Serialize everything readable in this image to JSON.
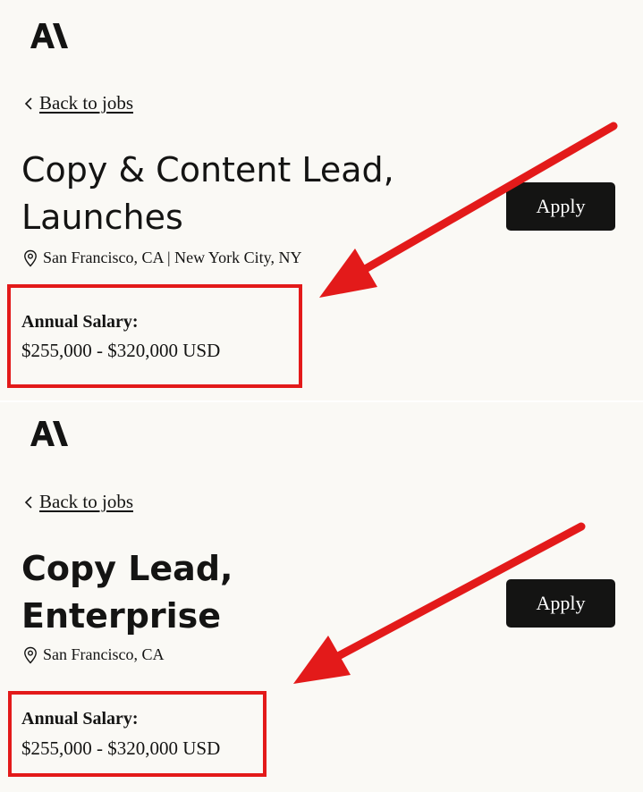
{
  "panels": [
    {
      "back_link": "Back to jobs",
      "title_line1": "Copy & Content Lead,",
      "title_line2": "Launches",
      "location": "San Francisco, CA | New York City, NY",
      "salary_label": "Annual Salary:",
      "salary_value": "$255,000 - $320,000 USD",
      "apply_label": "Apply"
    },
    {
      "back_link": "Back to jobs",
      "title_line1": "Copy Lead,",
      "title_line2": "Enterprise",
      "location": "San Francisco, CA",
      "salary_label": "Annual Salary:",
      "salary_value": "$255,000 - $320,000 USD",
      "apply_label": "Apply"
    }
  ],
  "colors": {
    "background": "#faf9f5",
    "text": "#141413",
    "button": "#141413",
    "annotation": "#e31a1a"
  },
  "icons": [
    "anthropic-logo",
    "chevron-left-icon",
    "map-pin-icon",
    "red-arrow-annotation"
  ]
}
